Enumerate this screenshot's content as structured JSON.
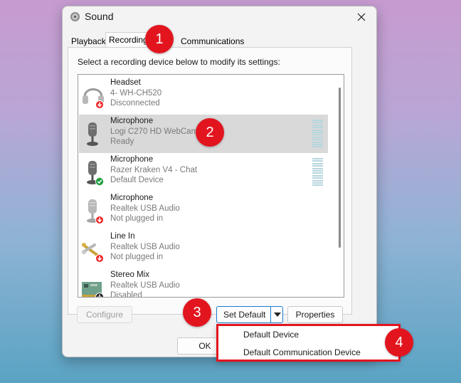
{
  "window": {
    "title": "Sound",
    "app_icon": "speaker-icon",
    "close_icon": "close-icon"
  },
  "tabs": [
    {
      "label": "Playback"
    },
    {
      "label": "Recording"
    },
    {
      "label": "Communications"
    }
  ],
  "panel": {
    "instruction": "Select a recording device below to modify its settings:"
  },
  "devices": [
    {
      "name": "Headset",
      "model": "4- WH-CH520",
      "status": "Disconnected",
      "icon": "headset-icon",
      "overlay": "red-down-arrow"
    },
    {
      "name": "Microphone",
      "model": "Logi C270 HD WebCam",
      "status": "Ready",
      "icon": "microphone-icon",
      "selected": true
    },
    {
      "name": "Microphone",
      "model": "Razer Kraken V4 - Chat",
      "status": "Default Device",
      "icon": "microphone-icon",
      "overlay": "green-check"
    },
    {
      "name": "Microphone",
      "model": "Realtek USB Audio",
      "status": "Not plugged in",
      "icon": "microphone-icon",
      "overlay": "red-down-arrow"
    },
    {
      "name": "Line In",
      "model": "Realtek USB Audio",
      "status": "Not plugged in",
      "icon": "line-in-cable-icon",
      "overlay": "red-down-arrow"
    },
    {
      "name": "Stereo Mix",
      "model": "Realtek USB Audio",
      "status": "Disabled",
      "icon": "sound-card-icon",
      "overlay": "down-arrow"
    }
  ],
  "buttons": {
    "configure": "Configure",
    "set_default": "Set Default",
    "properties": "Properties",
    "ok": "OK"
  },
  "dropdown_menu": [
    {
      "label": "Default Device"
    },
    {
      "label": "Default Communication Device"
    }
  ],
  "step_badges": [
    "1",
    "2",
    "3",
    "4"
  ],
  "colors": {
    "accent": "#1b7bd1",
    "badge_red": "#e2151e",
    "selected_row": "#d9d9d9"
  }
}
